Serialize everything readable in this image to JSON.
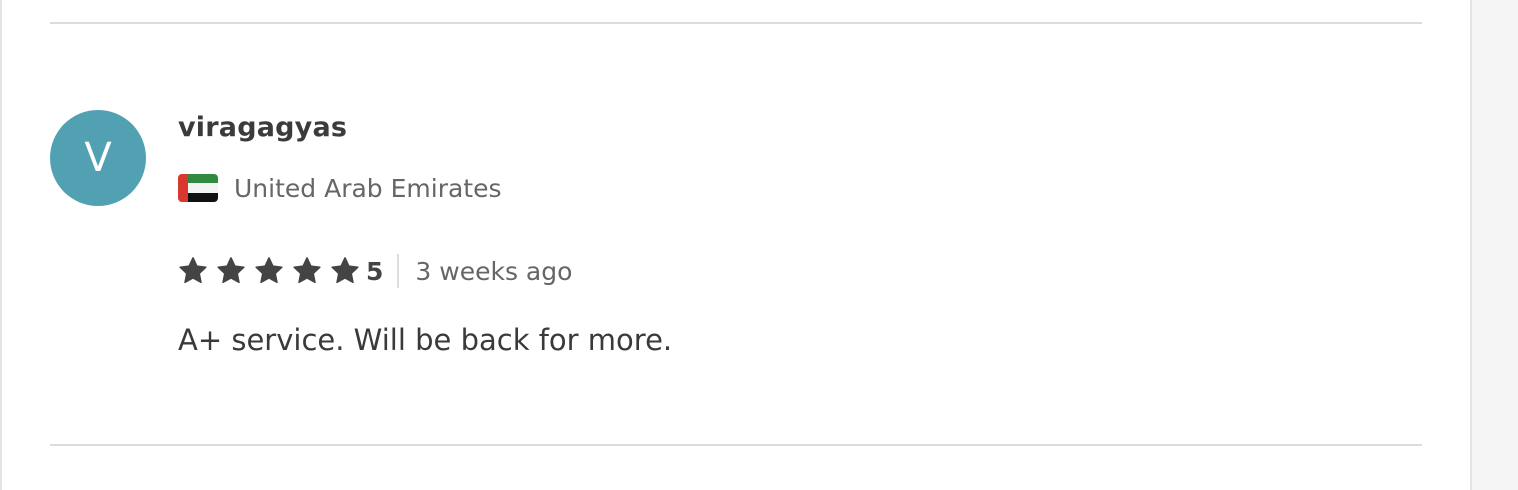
{
  "review": {
    "avatar_initial": "V",
    "avatar_color": "#52a1b3",
    "username": "viragagyas",
    "country": "United Arab Emirates",
    "flag_icon": "uae-flag-icon",
    "rating": 5,
    "rating_label": "5",
    "star_icon": "star-icon",
    "star_color": "#444444",
    "time_ago": "3 weeks ago",
    "text": "A+ service. Will be back for more."
  }
}
